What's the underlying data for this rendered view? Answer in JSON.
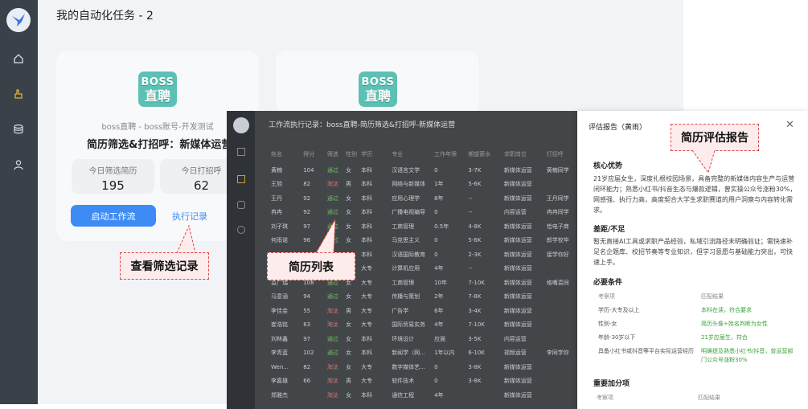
{
  "header": {
    "title": "我的自动化任务 - 2"
  },
  "sidebar": {
    "items": [
      "home-icon",
      "hand-icon",
      "database-icon",
      "user-icon"
    ]
  },
  "card1": {
    "logo_top": "BOSS",
    "logo_bottom": "直聘",
    "subtitle": "boss直聘 - boss账号-开发测试",
    "title": "简历筛选&打招呼：新媒体运营",
    "stat1_label": "今日筛选简历",
    "stat1_value": "195",
    "stat2_label": "今日打招呼",
    "stat2_value": "62",
    "start_btn": "启动工作流",
    "record_link": "执行记录"
  },
  "card2": {
    "logo_top": "BOSS",
    "logo_bottom": "直聘"
  },
  "callouts": {
    "records": "查看筛选记录",
    "list": "简历列表",
    "report": "简历评估报告"
  },
  "overlay": {
    "title": "工作流执行记录：boss直聘-简历筛选&打招呼-新媒体运营",
    "columns": [
      "姓名",
      "得分",
      "筛选",
      "性别",
      "学历",
      "专业",
      "工作年限",
      "期望薪水",
      "求职岗位",
      "打招呼"
    ],
    "rows": [
      [
        "黄楠",
        "104",
        "通过",
        "女",
        "本科",
        "汉语言文学",
        "0",
        "3-7K",
        "新媒体运营",
        "黄楠同学"
      ],
      [
        "王旭",
        "82",
        "淘汰",
        "男",
        "本科",
        "网络与新媒体",
        "1年",
        "5-6K",
        "新媒体运营",
        ""
      ],
      [
        "王丹",
        "92",
        "通过",
        "女",
        "本科",
        "应用心理学",
        "8年",
        "--",
        "新媒体运营",
        "王丹同学"
      ],
      [
        "冉冉",
        "92",
        "通过",
        "女",
        "本科",
        "广播电视编导",
        "0",
        "--",
        "内容运营",
        "冉冉同学"
      ],
      [
        "刘子琪",
        "97",
        "通过",
        "女",
        "本科",
        "工商管理",
        "0.5年",
        "4-8K",
        "新媒体运营",
        "恰电子商"
      ],
      [
        "何雨诺",
        "96",
        "通过",
        "女",
        "本科",
        "马克思主义",
        "0",
        "5-6K",
        "新媒体运营",
        "郎学校毕"
      ],
      [
        "",
        "",
        "通过",
        "女",
        "本科",
        "汉语国际教育",
        "0",
        "2-3K",
        "新媒体运营",
        "接学你好"
      ],
      [
        "",
        "",
        "通过",
        "女",
        "大专",
        "计算机应用",
        "4年",
        "--",
        "新媒体运营",
        ""
      ],
      [
        "袁广瑞",
        "108",
        "通过",
        "女",
        "大专",
        "工商管理",
        "10年",
        "7-10K",
        "新媒体运营",
        "格嘴袁同"
      ],
      [
        "马意涵",
        "94",
        "通过",
        "女",
        "大专",
        "传播与策划",
        "2年",
        "7-8K",
        "新媒体运营",
        ""
      ],
      [
        "李佳金",
        "55",
        "淘汰",
        "男",
        "大专",
        "广告学",
        "6年",
        "3-4K",
        "新媒体运营",
        ""
      ],
      [
        "崔浩铭",
        "63",
        "淘汰",
        "女",
        "大专",
        "国际贸易实务",
        "4年",
        "7-10K",
        "新媒体运营",
        ""
      ],
      [
        "刘林鑫",
        "97",
        "通过",
        "女",
        "本科",
        "环境设计",
        "应届",
        "3-5K",
        "内容运营",
        ""
      ],
      [
        "李青蓝",
        "102",
        "通过",
        "女",
        "本科",
        "新闻学（网...",
        "1年以内",
        "6-10K",
        "视频运营",
        "李同学你"
      ],
      [
        "Wen...",
        "82",
        "淘汰",
        "女",
        "大专",
        "数字媒体艺...",
        "0",
        "3-8K",
        "新媒体运营",
        ""
      ],
      [
        "李嘉雄",
        "66",
        "淘汰",
        "男",
        "大专",
        "软件技术",
        "0",
        "3-8K",
        "新媒体运营",
        ""
      ],
      [
        "郑雅杰",
        "",
        "淘汰",
        "女",
        "本科",
        "通信工程",
        "4年",
        "",
        "新媒体运营",
        ""
      ]
    ]
  },
  "panel": {
    "header": "评估报告（黄雨）",
    "core_title": "核心优势",
    "core_text": "21岁应届女生，深度扎根校园场景，具备完整的新媒体内容生产与运营闭环能力；熟悉小红书/抖音生态与爆款逻辑，曾实操公众号涨粉30%，网感强、执行力高，高度契合大学生求职赛道的用户洞察与内容转化需求。",
    "gap_title": "差距/不足",
    "gap_text": "暂无直接AI工具或求职产品经验，私域引流路径未明确验证；需快速补足名企题库、校招节奏等专业知识，但学习意愿与基础能力突出，可快速上手。",
    "must_title": "必要条件",
    "col1": "考察项",
    "col2": "匹配结果",
    "must_rows": [
      [
        "学历-大专及以上",
        "本科在读，符合要求"
      ],
      [
        "性别-女",
        "简历头像+姓名判断为女性"
      ],
      [
        "年龄-30岁以下",
        "21岁应届生，符合"
      ],
      [
        "具备小红书或抖音等平台实际运营经历",
        "明确提及熟悉小红书/抖音，曾运营部门公众号涨粉30%"
      ]
    ],
    "bonus_title": "重要加分项",
    "bcol1": "考察项",
    "bcol2": "匹配结果"
  }
}
